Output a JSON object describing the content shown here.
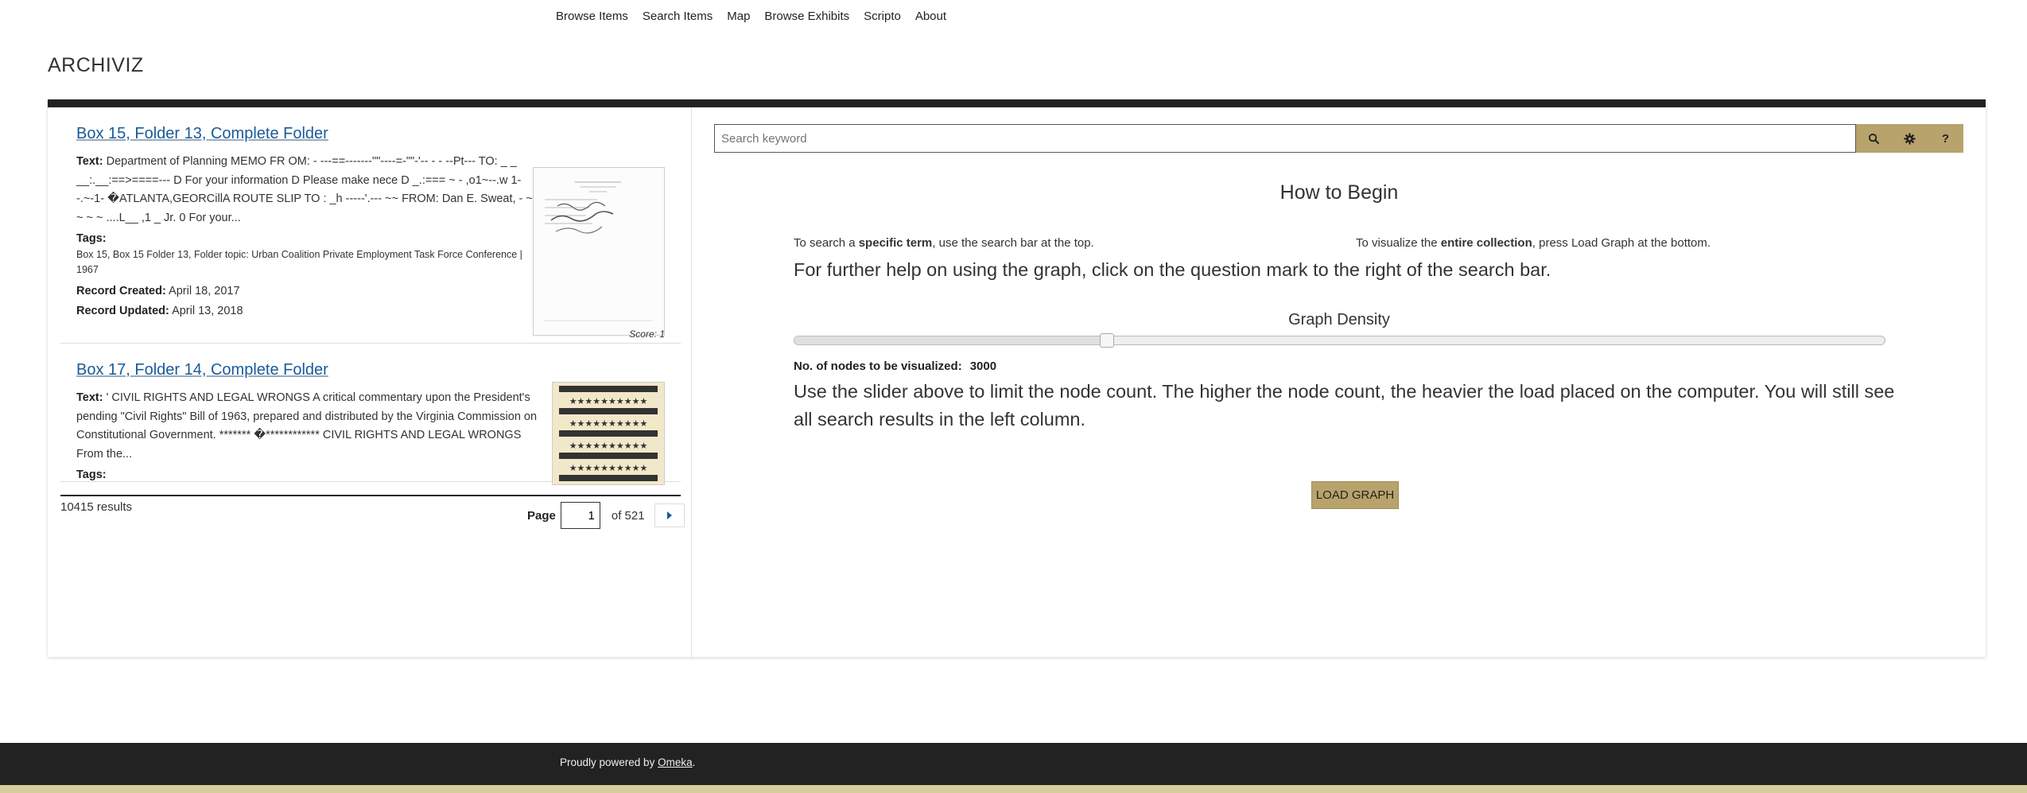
{
  "nav": {
    "items": [
      "Browse Items",
      "Search Items",
      "Map",
      "Browse Exhibits",
      "Scripto",
      "About"
    ]
  },
  "site": {
    "title": "ARCHIVIZ"
  },
  "results": {
    "items": [
      {
        "title": "Box 15, Folder 13, Complete Folder",
        "text_label": "Text:",
        "text": "Department of Planning MEMO FR OM: - ---==-------\"\"----=-\"\"-'-- - - --Pt--- TO: _ _ __:.__:==>====--- D For your information D Please make nece D _.:=== ~ - ,o1~--.w 1--.~-1- �ATLANTA,GEORCillA ROUTE SLIP TO : _h -----'.--- ~~ FROM: Dan E. Sweat, - ~ ~ ~ ~ ....L__ ,1 _ Jr. 0 For your...",
        "tags_label": "Tags:",
        "tags": "Box 15, Box 15 Folder 13, Folder topic: Urban Coalition Private Employment Task Force Conference | 1967",
        "created_label": "Record Created:",
        "created": "April 18, 2017",
        "updated_label": "Record Updated:",
        "updated": "April 13, 2018",
        "score": "Score: 1"
      },
      {
        "title": "Box 17, Folder 14, Complete Folder",
        "text_label": "Text:",
        "text": "' CIVIL RIGHTS AND LEGAL WRONGS A critical commentary upon the President's pending \"Civil Rights\" Bill of 1963, prepared and distributed by the Virginia Commission on Constitutional Government. ******* �************ CIVIL RIGHTS AND LEGAL WRONGS From the...",
        "tags_label": "Tags:"
      }
    ],
    "count": "10415 results",
    "page_label": "Page",
    "page_value": "1",
    "of_label": "of 521"
  },
  "search": {
    "placeholder": "Search keyword"
  },
  "help": {
    "heading": "How to Begin",
    "hint_left_pre": "To search a ",
    "hint_left_bold": "specific term",
    "hint_left_post": ", use the search bar at the top.",
    "hint_right_pre": "To visualize the ",
    "hint_right_bold": "entire collection",
    "hint_right_post": ", press Load Graph at the bottom.",
    "further": "For further help on using the graph, click on the question mark to the right of the search bar.",
    "density_title": "Graph Density",
    "nodes_label": "No. of nodes to be visualized:",
    "nodes_value": "3000",
    "slider_fraction": 0.287,
    "limit": "Use the slider above to limit the node count. The higher the node count, the heavier the load placed on the computer. You will still see all search results in the left column.",
    "load_button": "LOAD GRAPH"
  },
  "footer": {
    "prefix": "Proudly powered by ",
    "link": "Omeka",
    "suffix": "."
  },
  "colors": {
    "accent": "#b7a36b",
    "dark": "#222222",
    "link": "#1a5a9a",
    "footer_strip": "#d6cc9e"
  }
}
